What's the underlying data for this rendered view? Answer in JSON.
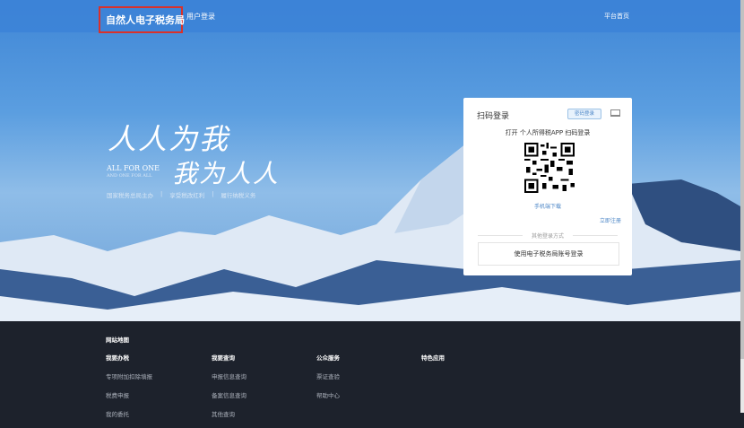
{
  "header": {
    "brand": "自然人电子税务局",
    "login": "用户登录",
    "home": "平台首页"
  },
  "hero": {
    "slogan_line1": "人人为我",
    "slogan_line2": "我为人人",
    "english1": "ALL FOR ONE",
    "english2": "AND ONE FOR ALL",
    "taglines": [
      "国家税务总局主办",
      "享受税改红利",
      "履行纳税义务"
    ]
  },
  "login_card": {
    "title": "扫码登录",
    "password_login": "密码登录",
    "scan_tip": "打开 个人所得税APP 扫码登录",
    "download": "手机端下载",
    "register": "立即注册",
    "other_methods": "其他登录方式",
    "account_login": "使用电子税务局账号登录"
  },
  "footer": {
    "sitemap": "网站地图",
    "columns": [
      {
        "title": "我要办税",
        "items": [
          "专项附加扣除填报",
          "税费申报",
          "我的委托"
        ]
      },
      {
        "title": "我要查询",
        "items": [
          "申报信息查询",
          "备案信息查询",
          "其他查询"
        ]
      },
      {
        "title": "公众服务",
        "items": [
          "票证查验",
          "帮助中心"
        ]
      },
      {
        "title": "特色应用",
        "items": []
      }
    ]
  }
}
